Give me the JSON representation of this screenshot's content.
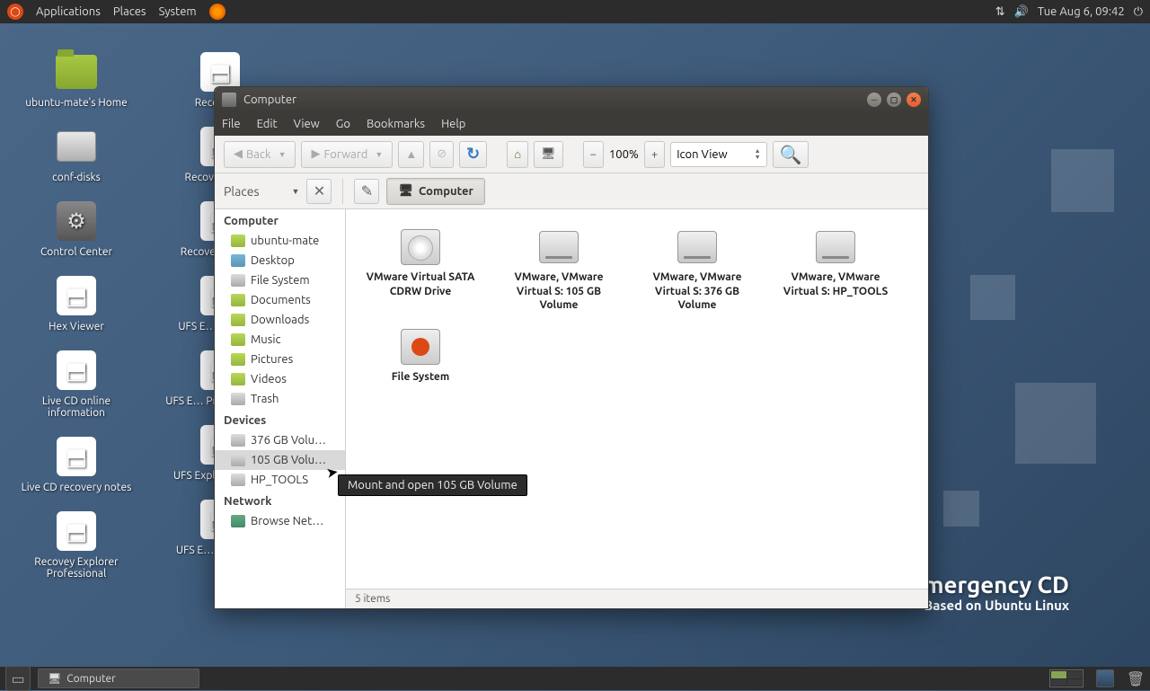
{
  "top_panel": {
    "menus": [
      "Applications",
      "Places",
      "System"
    ],
    "datetime": "Tue Aug  6, 09:42"
  },
  "desktop_icons_col1": [
    {
      "label": "ubuntu-mate's Home",
      "type": "folder"
    },
    {
      "label": "conf-disks",
      "type": "disk"
    },
    {
      "label": "Control Center",
      "type": "gear"
    },
    {
      "label": "Hex Viewer",
      "type": "app"
    },
    {
      "label": "Live CD online information",
      "type": "app"
    },
    {
      "label": "Live CD recovery notes",
      "type": "app"
    },
    {
      "label": "Recovey Explorer Professional",
      "type": "app"
    }
  ],
  "desktop_icons_col2": [
    {
      "label": "Recovey…",
      "type": "app"
    },
    {
      "label": "Recovey… R…",
      "type": "app"
    },
    {
      "label": "Recovey… Sta…",
      "type": "app"
    },
    {
      "label": "UFS E… Netwo…",
      "type": "app"
    },
    {
      "label": "UFS E… Profe… Rec…",
      "type": "app"
    },
    {
      "label": "UFS Explor… Rec…",
      "type": "app"
    },
    {
      "label": "UFS E… Standar…",
      "type": "app"
    }
  ],
  "wallpaper": {
    "line1": "UFS Explorer Emergency CD",
    "line2": "Based on Ubuntu Linux"
  },
  "window": {
    "title": "Computer",
    "menus": [
      "File",
      "Edit",
      "View",
      "Go",
      "Bookmarks",
      "Help"
    ],
    "toolbar": {
      "back": "Back",
      "forward": "Forward",
      "zoom": "100%",
      "view_mode": "Icon View"
    },
    "toolbar2": {
      "places": "Places",
      "path": "Computer"
    },
    "sidebar": {
      "groups": [
        {
          "title": "Computer",
          "items": [
            {
              "label": "ubuntu-mate",
              "icon": "fold"
            },
            {
              "label": "Desktop",
              "icon": "desk"
            },
            {
              "label": "File System",
              "icon": "disk"
            },
            {
              "label": "Documents",
              "icon": "fold"
            },
            {
              "label": "Downloads",
              "icon": "fold"
            },
            {
              "label": "Music",
              "icon": "fold"
            },
            {
              "label": "Pictures",
              "icon": "fold"
            },
            {
              "label": "Videos",
              "icon": "fold"
            },
            {
              "label": "Trash",
              "icon": "disk"
            }
          ]
        },
        {
          "title": "Devices",
          "items": [
            {
              "label": "376 GB Volu…",
              "icon": "disk"
            },
            {
              "label": "105 GB Volu…",
              "icon": "disk",
              "selected": true
            },
            {
              "label": "HP_TOOLS",
              "icon": "disk"
            }
          ]
        },
        {
          "title": "Network",
          "items": [
            {
              "label": "Browse Net…",
              "icon": "net"
            }
          ]
        }
      ]
    },
    "items": [
      {
        "label": "VMware Virtual SATA CDRW Drive",
        "icon": "cd"
      },
      {
        "label": "VMware, VMware Virtual S: 105 GB Volume",
        "icon": "drive"
      },
      {
        "label": "VMware, VMware Virtual S: 376 GB Volume",
        "icon": "drive"
      },
      {
        "label": "VMware, VMware Virtual S: HP_TOOLS",
        "icon": "drive"
      },
      {
        "label": "File System",
        "icon": "sys"
      }
    ],
    "status": "5 items"
  },
  "tooltip": "Mount and open 105 GB Volume",
  "taskbar": {
    "app": "Computer"
  }
}
